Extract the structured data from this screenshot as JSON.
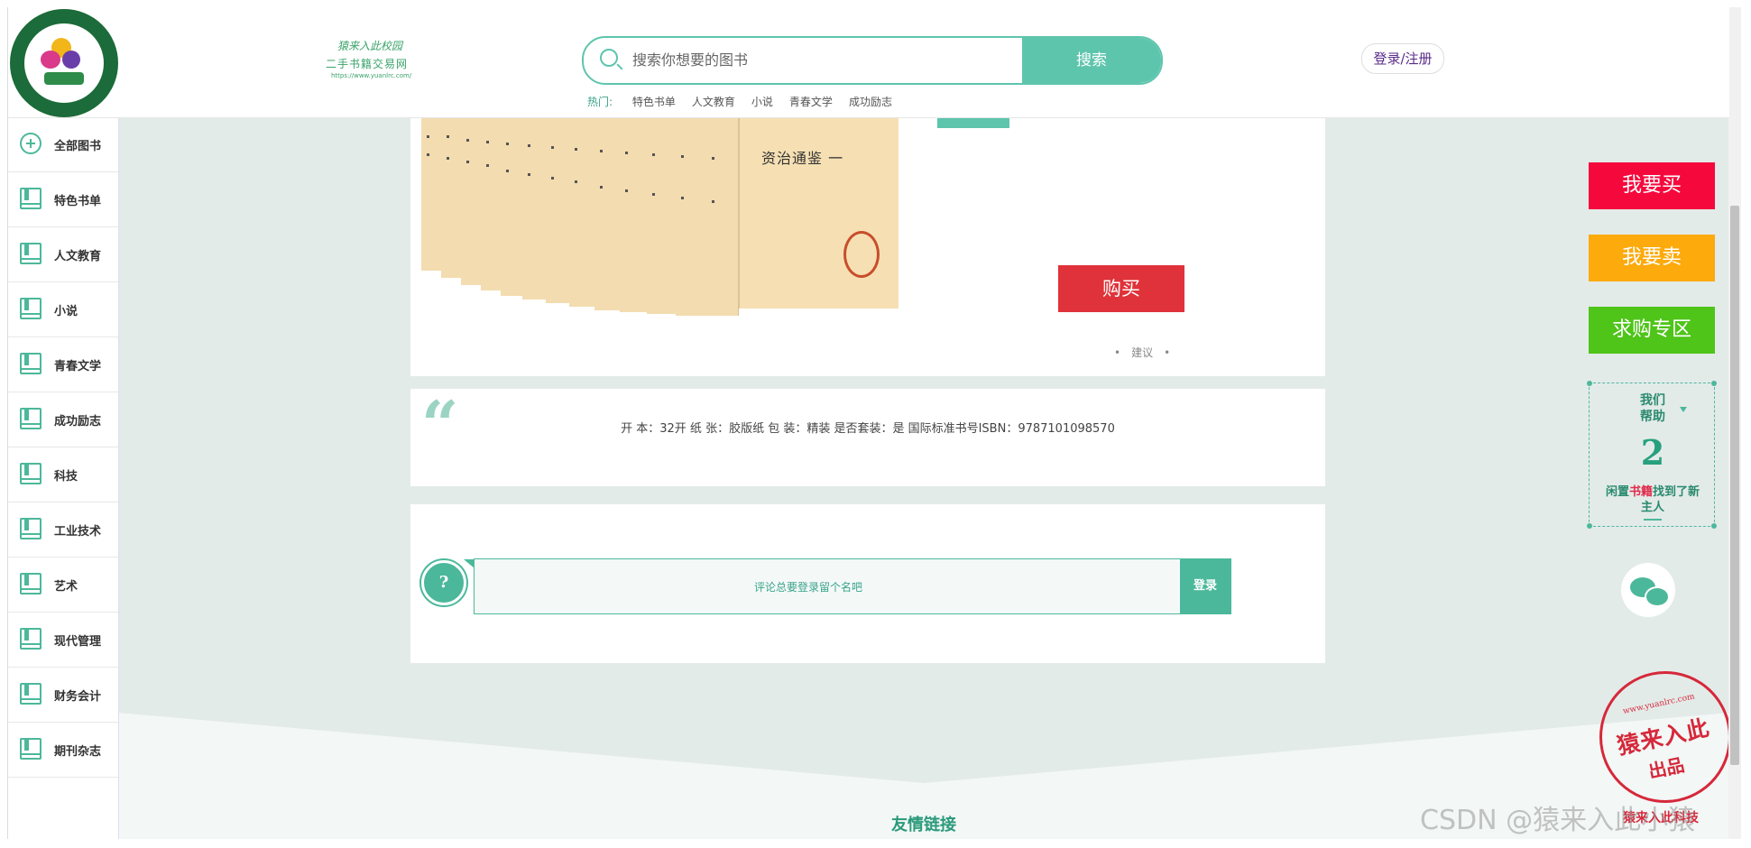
{
  "header": {
    "site_tagline": "猿来入此校园",
    "site_name": "二手书籍交易网",
    "site_url": "https://www.yuanlrc.com/",
    "search_placeholder": "搜索你想要的图书",
    "search_button": "搜索",
    "hot_label": "热门:",
    "hot_items": [
      "特色书单",
      "人文教育",
      "小说",
      "青春文学",
      "成功励志"
    ],
    "login_label": "登录/注册"
  },
  "sidebar": {
    "items": [
      {
        "label": "全部图书",
        "icon": "plus-circle-icon"
      },
      {
        "label": "特色书单",
        "icon": "book-icon"
      },
      {
        "label": "人文教育",
        "icon": "book-icon"
      },
      {
        "label": "小说",
        "icon": "book-icon"
      },
      {
        "label": "青春文学",
        "icon": "book-icon"
      },
      {
        "label": "成功励志",
        "icon": "book-icon"
      },
      {
        "label": "科技",
        "icon": "book-icon"
      },
      {
        "label": "工业技术",
        "icon": "book-icon"
      },
      {
        "label": "艺术",
        "icon": "book-icon"
      },
      {
        "label": "现代管理",
        "icon": "book-icon"
      },
      {
        "label": "财务会计",
        "icon": "book-icon"
      },
      {
        "label": "期刊杂志",
        "icon": "book-icon"
      }
    ]
  },
  "book": {
    "cover_title": "资治通鉴 一",
    "buy_button": "购买",
    "suggest_label": "建议"
  },
  "spec": {
    "quote_glyph": "“",
    "text": "开 本：32开 纸 张：胶版纸 包 装：精装 是否套装：是 国际标准书号ISBN：9787101098570"
  },
  "comment": {
    "q_glyph": "?",
    "placeholder": "评论总要登录留个名吧",
    "login_button": "登录"
  },
  "footer": {
    "title": "友情链接"
  },
  "floats": {
    "buy": "我要买",
    "sell": "我要卖",
    "want": "求购专区",
    "help_line1": "我们",
    "help_line2": "帮助",
    "help_count": "2",
    "help_text_a": "闲置",
    "help_text_red": "书籍",
    "help_text_b": "找到了新主人"
  },
  "stamp": {
    "url": "www.yuanlrc.com",
    "main": "猿来入此",
    "sub": "出品",
    "bottom": "猿来入此科技"
  },
  "watermark": "CSDN @猿来入此小猿",
  "colors": {
    "accent": "#5ec5ad",
    "buy_red": "#e0323a",
    "float_buy": "#f5093d",
    "float_sell": "#fcaa0c",
    "float_want": "#4fc419",
    "background": "#e3ebe9"
  }
}
